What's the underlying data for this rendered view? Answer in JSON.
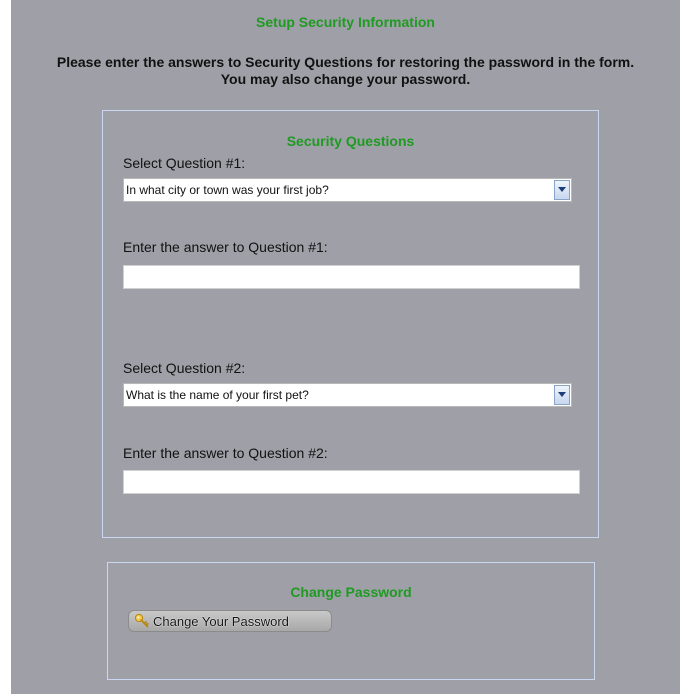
{
  "header": {
    "title": "Setup Security Information",
    "instructions_line1": "Please enter the answers to Security Questions for restoring the password in the form.",
    "instructions_line2": "You may also change your password."
  },
  "security_questions": {
    "title": "Security Questions",
    "question1": {
      "select_label": "Select Question #1:",
      "selected_value": "In what city or town was your first job?",
      "answer_label": "Enter the answer to Question #1:",
      "answer_value": ""
    },
    "question2": {
      "select_label": "Select Question #2:",
      "selected_value": "What is the name of your first pet?",
      "answer_label": "Enter the answer to Question #2:",
      "answer_value": ""
    }
  },
  "change_password": {
    "title": "Change Password",
    "button_label": "Change Your Password",
    "button_icon": "key-icon"
  },
  "colors": {
    "background": "#9fa0a7",
    "section_title": "#1f9a22",
    "panel_border": "#c9d8f0"
  }
}
